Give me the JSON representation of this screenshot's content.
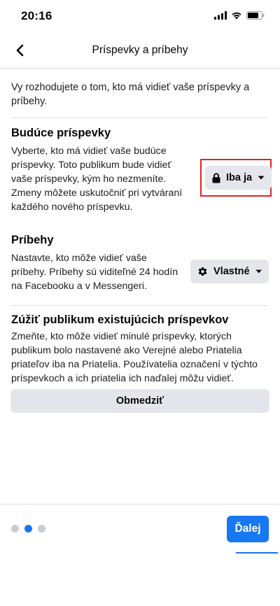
{
  "status_bar": {
    "time": "20:16"
  },
  "header": {
    "title": "Príspevky a príbehy",
    "back_icon": "chevron-left-icon"
  },
  "intro": "Vy rozhodujete o tom, kto má vidieť vaše príspevky a príbehy.",
  "future_posts": {
    "title": "Budúce príspevky",
    "line1": "Vyberte, kto má vidieť vaše budúce",
    "line2": "príspevky. Toto publikum bude vidieť",
    "line3": "vaše príspevky, kým ho nezmeníte.",
    "line4": "Zmeny môžete uskutočniť pri vytváraní",
    "line5": "každého nového príspevku.",
    "audience_label": "Iba ja",
    "audience_icon": "lock-icon"
  },
  "stories": {
    "title": "Príbehy",
    "line1": "Nastavte, kto môže vidieť vaše",
    "line2": "príbehy. Príbehy sú viditeľné 24 hodín",
    "line3": "na Facebooku a v Messengeri.",
    "audience_label": "Vlastné",
    "audience_icon": "gear-icon"
  },
  "limit_past": {
    "title": "Zúžiť publikum existujúcich príspevkov",
    "line1": "Zmeňte, kto môže vidieť minulé príspevky, ktorých",
    "line2": "publikum bolo nastavené ako Verejné alebo Priatelia",
    "line3": "priateľov iba na Priatelia. Používatelia označení v týchto",
    "line4": "príspevkoch a ich priatelia ich naďalej môžu vidieť.",
    "button_label": "Obmedziť"
  },
  "footer": {
    "pager": {
      "total": 3,
      "active": 2
    },
    "next_label": "Ďalej"
  },
  "colors": {
    "accent": "#1877f2",
    "highlight": "#e02424",
    "button_bg": "#e4e6eb"
  }
}
